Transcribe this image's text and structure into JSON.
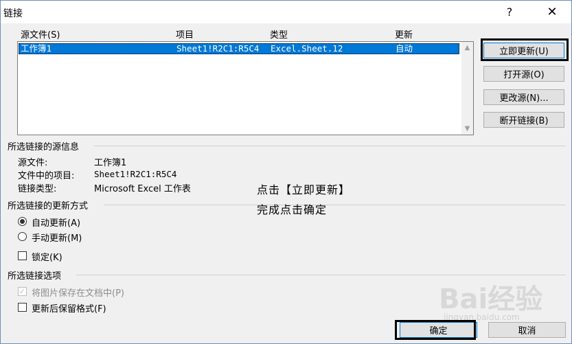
{
  "window": {
    "title": "链接",
    "help_label": "?",
    "close_label": "✕"
  },
  "columns": {
    "source": "源文件(S)",
    "item": "项目",
    "type": "类型",
    "update": "更新"
  },
  "links": [
    {
      "source": "工作簿1",
      "item": "Sheet1!R2C1:R5C4",
      "type": "Excel.Sheet.12",
      "update": "自动"
    }
  ],
  "buttons": {
    "update_now": "立即更新(U)",
    "open_source": "打开源(O)",
    "change_source": "更改源(N)...",
    "break_link": "断开链接(B)",
    "ok": "确定",
    "cancel": "取消"
  },
  "source_info": {
    "heading": "所选链接的源信息",
    "source_file_label": "源文件:",
    "source_file_value": "工作簿1",
    "item_label": "文件中的项目:",
    "item_value": "Sheet1!R2C1:R5C4",
    "link_type_label": "链接类型:",
    "link_type_value": "Microsoft Excel 工作表"
  },
  "update_method": {
    "heading": "所选链接的更新方式",
    "auto_label": "自动更新(A)",
    "manual_label": "手动更新(M)",
    "lock_label": "锁定(K)",
    "selected": "auto"
  },
  "options": {
    "heading": "所选链接选项",
    "save_picture_label": "将图片保存在文档中(P)",
    "keep_format_label": "更新后保留格式(F)"
  },
  "annotation": {
    "line1": "点击【立即更新】",
    "line2": "完成点击确定"
  },
  "watermark": {
    "text": "Bai经验",
    "sub": "jingyan.baidu.com"
  }
}
